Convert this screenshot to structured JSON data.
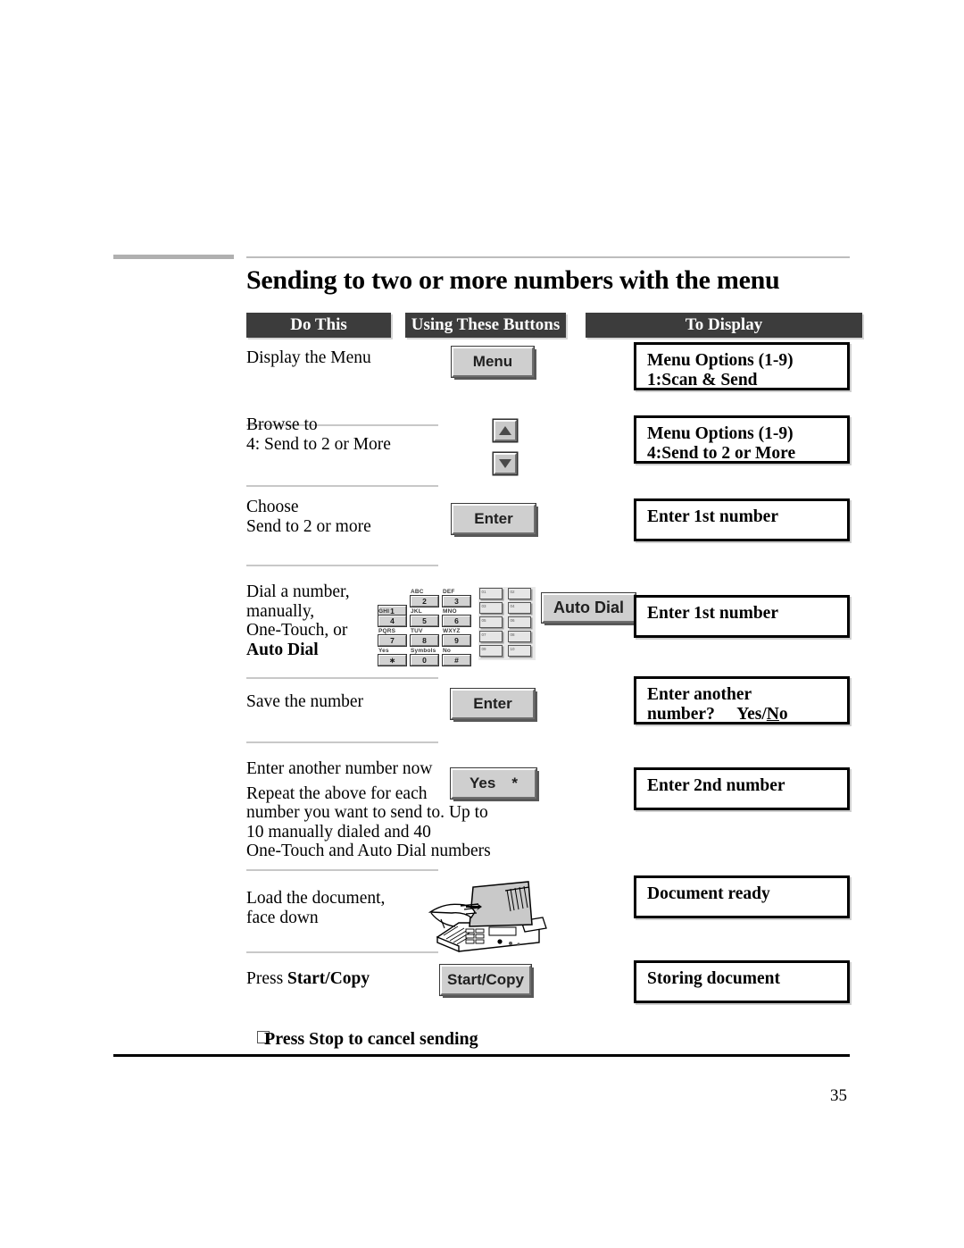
{
  "document": {
    "title": "Sending to two or more numbers with the menu",
    "page_number": "35",
    "footer_note": "Press Stop to cancel sending"
  },
  "table": {
    "headers": {
      "do_this": "Do This",
      "using_these_buttons": "Using These Buttons",
      "to_display": "To Display"
    },
    "rows": [
      {
        "do_this": [
          "Display the Menu"
        ],
        "button": "Menu",
        "display": [
          "Menu Options (1-9)",
          "1:Scan & Send"
        ]
      },
      {
        "do_this": [
          "Browse to",
          "4: Send to 2 or  More"
        ],
        "button_up": "up-arrow",
        "button_down": "down-arrow",
        "display": [
          "Menu Options (1-9)",
          "4:Send to 2 or More"
        ]
      },
      {
        "do_this": [
          "Choose",
          "Send to 2 or more"
        ],
        "button": "Enter",
        "display": [
          "Enter 1st number"
        ]
      },
      {
        "do_this": [
          "Dial a number,",
          "manually,",
          "One-Touch, or",
          "Auto Dial"
        ],
        "do_this_bold_last": true,
        "button": "Auto Dial",
        "display": [
          "Enter 1st number"
        ]
      },
      {
        "do_this": [
          "Save the number"
        ],
        "button": "Enter",
        "display": [
          "Enter another",
          "number?      Yes/No"
        ],
        "display_underline_char": "N"
      },
      {
        "do_this": [
          "Enter another number now",
          "Repeat the above for each",
          "number you want to send to.  Up to",
          "10 manually dialed and 40",
          "One-Touch and Auto Dial numbers"
        ],
        "button": "Yes",
        "button_secondary": "*",
        "display": [
          "Enter 2nd number"
        ]
      },
      {
        "do_this": [
          "Load the document,",
          "face down"
        ],
        "button": "fax-loading-illustration",
        "display": [
          "Document ready"
        ]
      },
      {
        "do_this": [
          "Press Start/Copy"
        ],
        "do_this_bold_tail": "Start/Copy",
        "button": "Start/Copy",
        "display": [
          "Storing document"
        ]
      }
    ]
  },
  "keypad": {
    "keys": [
      {
        "letters": "",
        "digit": "1"
      },
      {
        "letters": "ABC",
        "digit": "2"
      },
      {
        "letters": "DEF",
        "digit": "3"
      },
      {
        "letters": "GHI",
        "digit": "4"
      },
      {
        "letters": "JKL",
        "digit": "5"
      },
      {
        "letters": "MNO",
        "digit": "6"
      },
      {
        "letters": "PQRS",
        "digit": "7"
      },
      {
        "letters": "TUV",
        "digit": "8"
      },
      {
        "letters": "WXYZ",
        "digit": "9"
      },
      {
        "letters": "Yes",
        "digit": "∗"
      },
      {
        "letters": "Symbols",
        "digit": "0"
      },
      {
        "letters": "No",
        "digit": "#"
      }
    ],
    "one_touch_labels": [
      "01",
      "02",
      "03",
      "04",
      "05",
      "06",
      "07",
      "08",
      "09",
      "10"
    ],
    "auto_dial_label": "Auto Dial"
  },
  "colors": {
    "header_bar": "#3c3c3c",
    "header_text": "#ffffff",
    "divider": "#c8c8c8",
    "rule_thick": "#b0b0b0",
    "button_face": "#cfcfcf"
  }
}
